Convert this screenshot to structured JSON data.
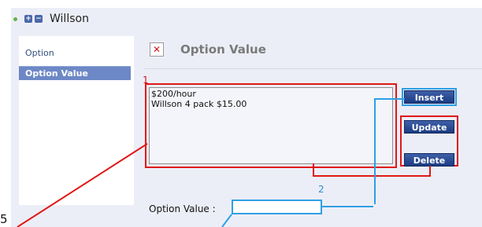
{
  "breadcrumb": {
    "label": "Willson",
    "expand_icon": "plus-square-icon",
    "collapse_icon": "minus-square-icon"
  },
  "sidebar": {
    "items": [
      {
        "label": "Option"
      },
      {
        "label": "Option Value"
      }
    ]
  },
  "heading": {
    "title": "Option Value",
    "icon": "close-box-icon"
  },
  "annotations": {
    "one": "1",
    "two": "2"
  },
  "list": {
    "items": [
      "$200/hour",
      "Willson 4 pack $15.00"
    ]
  },
  "buttons": {
    "insert": "Insert",
    "update": "Update",
    "delete": "Delete"
  },
  "form": {
    "label": "Option Value :",
    "value": ""
  },
  "edge_glyph": "5",
  "colors": {
    "annotation_red": "#e01818",
    "annotation_blue": "#2f9fe4",
    "button_blue": "#1b3b82"
  }
}
